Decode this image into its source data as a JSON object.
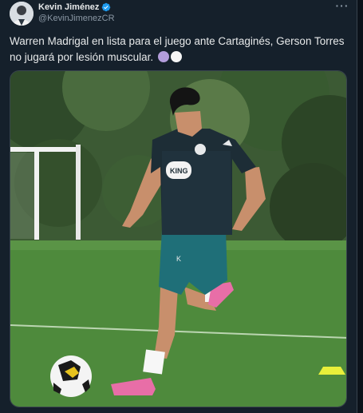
{
  "author": {
    "name": "Kevin Jiménez",
    "handle": "@KevinJimenezCR",
    "verified": true,
    "avatar_icon": "user-avatar"
  },
  "tweet": {
    "text": "Warren Madrigal en lista para el juego ante Cartaginés, Gerson Torres no jugará por lesión muscular.",
    "emojis": [
      "purple-circle",
      "white-circle"
    ]
  },
  "more_menu": {
    "label": "···"
  },
  "media": {
    "jersey_logo": "KING",
    "colors": {
      "grass": "#4e8a3c",
      "jersey": "#1d2d36",
      "shorts": "#1f6f78",
      "shoes": "#e86ea7",
      "trees": "#2f4a2a"
    }
  },
  "theme": {
    "background": "#15202b",
    "text": "#e7e9ea",
    "secondary_text": "#8b98a5",
    "verified_blue": "#1d9bf0",
    "border": "#38444d"
  }
}
